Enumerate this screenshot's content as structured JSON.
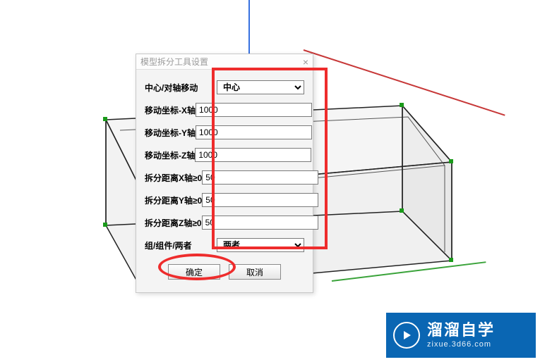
{
  "dialog": {
    "title": "模型拆分工具设置",
    "fields": {
      "center_axis": {
        "label": "中心/对轴移动",
        "value": "中心"
      },
      "move_x": {
        "label": "移动坐标-X轴",
        "value": "1000"
      },
      "move_y": {
        "label": "移动坐标-Y轴",
        "value": "1000"
      },
      "move_z": {
        "label": "移动坐标-Z轴",
        "value": "1000"
      },
      "split_x": {
        "label": "拆分距离X轴≥0",
        "value": "50"
      },
      "split_y": {
        "label": "拆分距离Y轴≥0",
        "value": "50"
      },
      "split_z": {
        "label": "拆分距离Z轴≥0",
        "value": "50"
      },
      "group_comp": {
        "label": "组/组件/两者",
        "value": "两者"
      }
    },
    "buttons": {
      "ok": "确定",
      "cancel": "取消"
    }
  },
  "watermark": {
    "main": "溜溜自学",
    "sub": "zixue.3d66.com"
  }
}
